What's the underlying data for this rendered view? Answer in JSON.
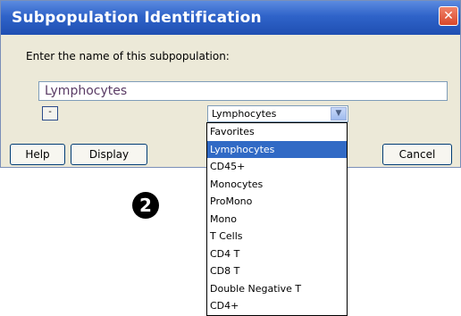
{
  "window": {
    "title": "Subpopulation Identification",
    "close_glyph": "✕"
  },
  "prompt": "Enter the name of this subpopulation:",
  "name_input": {
    "value": "Lymphocytes"
  },
  "minus_button": {
    "label": "-"
  },
  "select": {
    "value": "Lymphocytes",
    "arrow_glyph": "▼"
  },
  "buttons": {
    "help": "Help",
    "display": "Display",
    "cancel": "Cancel"
  },
  "dropdown": {
    "items": [
      "Favorites",
      "Lymphocytes",
      "CD45+",
      "Monocytes",
      "ProMono",
      "Mono",
      "T Cells",
      "CD4 T",
      "CD8 T",
      "Double Negative T",
      "CD4+"
    ],
    "selected": "Lymphocytes"
  },
  "marker": {
    "label": "2"
  },
  "colors": {
    "titlebar": "#2f63c9",
    "selection": "#316ac5",
    "dialog_bg": "#ece9d8"
  }
}
